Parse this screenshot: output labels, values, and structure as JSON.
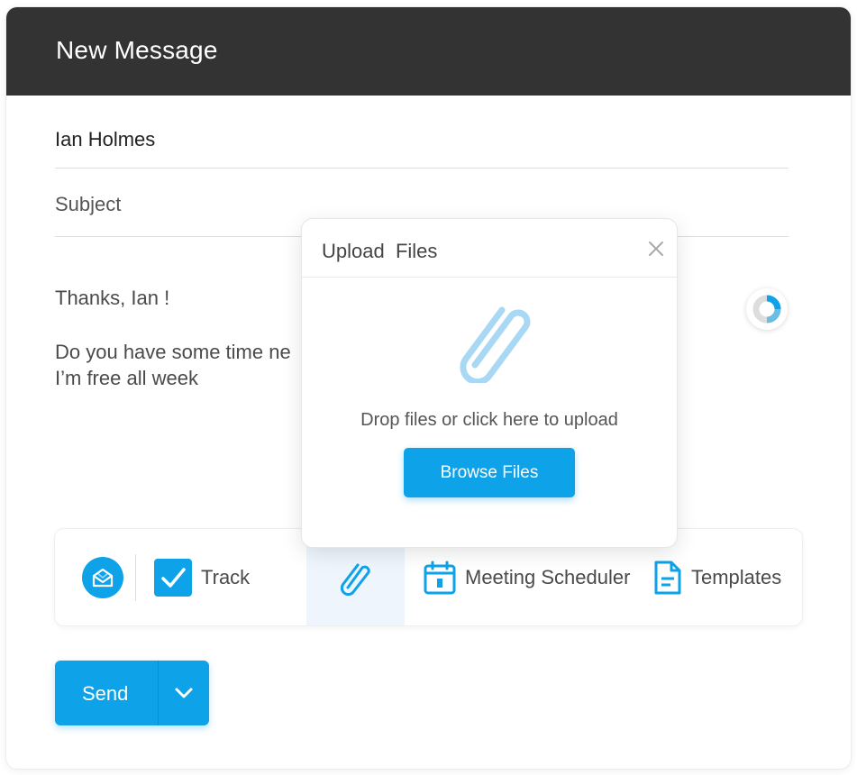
{
  "header": {
    "title": "New Message"
  },
  "compose": {
    "to_value": "Ian Holmes",
    "subject_placeholder": "Subject",
    "body_lines": [
      "Thanks, Ian !",
      "Do you have some time ne",
      "I’m free all week"
    ]
  },
  "toolbar": {
    "items": [
      {
        "icon": "envelope-open-icon"
      },
      {
        "icon": "checkbox-checked-icon",
        "label": "Track"
      },
      {
        "icon": "paperclip-icon",
        "active": true
      },
      {
        "icon": "calendar-icon",
        "label": "Meeting Scheduler"
      },
      {
        "icon": "document-icon",
        "label": "Templates"
      }
    ]
  },
  "send": {
    "label": "Send"
  },
  "upload_modal": {
    "title": "Upload  Files",
    "hint": "Drop files or click here to upload",
    "browse_label": "Browse Files"
  },
  "colors": {
    "header_bg": "#333333",
    "accent": "#0ea2e8",
    "active_tool_bg": "#eef5fd"
  }
}
